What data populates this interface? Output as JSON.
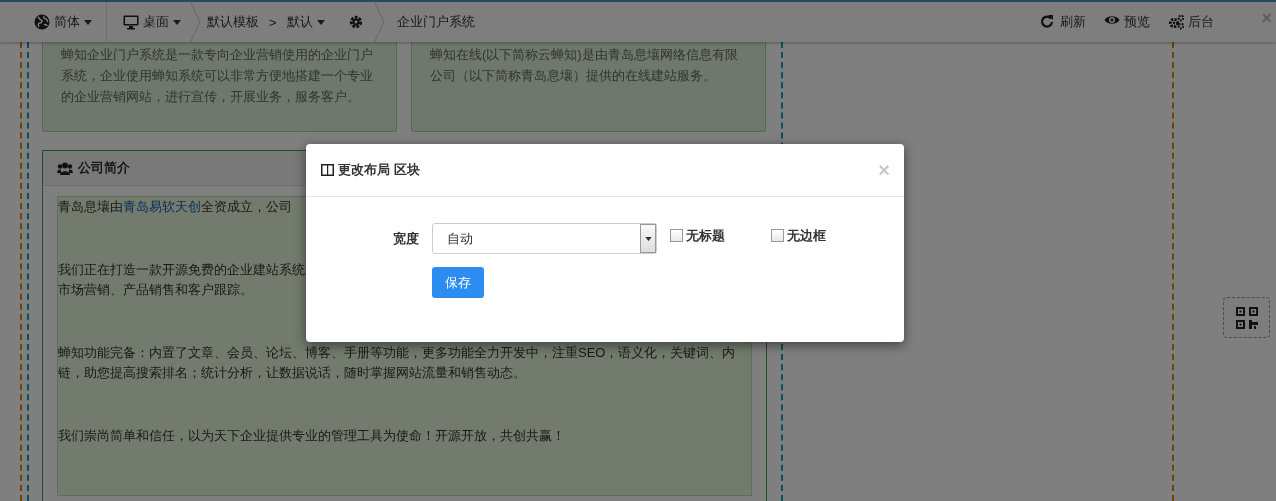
{
  "toolbar": {
    "language_menu": "简体",
    "device_menu": "桌面",
    "theme": "默认模板",
    "separator": ">",
    "theme_variant": "默认",
    "site_name": "企业门户系统",
    "actions": [
      {
        "label": "刷新"
      },
      {
        "label": "预览"
      },
      {
        "label": "后台"
      }
    ],
    "close": "×"
  },
  "cards": [
    {
      "text": "蝉知企业门户系统是一款专向企业营销使用的企业门户系统，企业使用蝉知系统可以非常方便地搭建一个专业的企业营销网站，进行宣传，开展业务，服务客户。"
    },
    {
      "text": "蝉知在线(以下简称云蝉知)是由青岛息壤网络信息有限公司（以下简称青岛息壤）提供的在线建站服务。"
    }
  ],
  "panel": {
    "title": "公司简介",
    "intro": {
      "before": "青岛息壤由",
      "link": "青岛易软天创",
      "after": "全资成立，公司"
    },
    "paragraphs": [
      "我们正在打造一款开源免费的企业建站系统",
      "市场营销、产品销售和客户跟踪。",
      "蝉知功能完备：内置了文章、会员、论坛、博客、手册等功能，更多功能全力开发中，注重SEO，语义化，关键词、内链，助您提高搜索排名；统计分析，让数据说话，随时掌握网站流量和销售动态。",
      "我们崇尚简单和信任，以为天下企业提供专业的管理工具为使命！开源开放，共创共赢！"
    ]
  },
  "modal": {
    "title": "更改布局 区块",
    "close": "×",
    "width_label": "宽度",
    "width_value": "自动",
    "checkboxes": [
      {
        "label": "无标题",
        "checked": false
      },
      {
        "label": "无边框",
        "checked": false
      }
    ],
    "save": "保存"
  }
}
